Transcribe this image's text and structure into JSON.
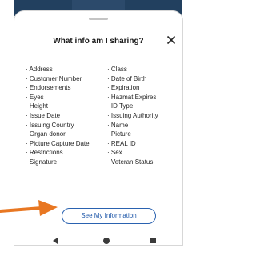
{
  "dialog": {
    "title": "What info am I sharing?",
    "close_icon": "close-icon"
  },
  "fields": {
    "left": [
      "· Address",
      "· Customer Number",
      "· Endorsements",
      "· Eyes",
      "· Height",
      "· Issue Date",
      "· Issuing Country",
      "· Organ donor",
      "· Picture Capture Date",
      "· Restrictions",
      "· Signature"
    ],
    "right": [
      "· Class",
      "· Date of Birth",
      "· Expiration",
      "· Hazmat Expires",
      "· ID Type",
      "· Issuing Authority",
      "· Name",
      "· Picture",
      "· REAL ID",
      "· Sex",
      "· Veteran Status"
    ]
  },
  "cta": {
    "label": "See My Information"
  },
  "nav": {
    "back_icon": "back-triangle-icon",
    "home_icon": "home-circle-icon",
    "recent_icon": "recent-square-icon"
  },
  "annotation": {
    "arrow_icon": "arrow-right-icon",
    "arrow_color": "#e87722"
  },
  "colors": {
    "accent": "#1d56a8",
    "background_header": "#2c4a6b"
  }
}
